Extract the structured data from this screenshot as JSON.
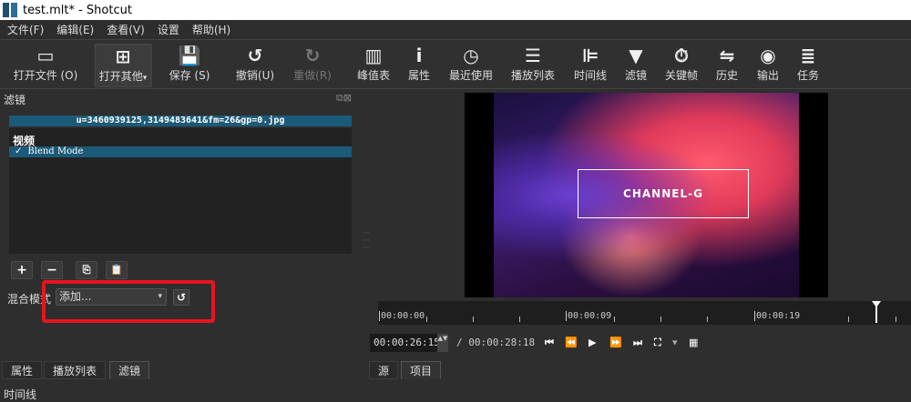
{
  "window": {
    "title": "test.mlt* - Shotcut"
  },
  "menu": [
    "文件(F)",
    "编辑(E)",
    "查看(V)",
    "设置",
    "帮助(H)"
  ],
  "toolbar": [
    {
      "label": "打开文件 (O)",
      "icon": "folder-icon",
      "glyph": "▭"
    },
    {
      "label": "打开其他",
      "icon": "open-other-icon",
      "glyph": "⊞",
      "active": true,
      "dropdown": "▾"
    },
    {
      "label": "保存 (S)",
      "icon": "save-icon",
      "glyph": "💾"
    },
    {
      "label": "撤销(U)",
      "icon": "undo-icon",
      "glyph": "↺"
    },
    {
      "label": "重做(R)",
      "icon": "redo-icon",
      "glyph": "↻",
      "disabled": true
    },
    {
      "label": "峰值表",
      "icon": "peak-meter-icon",
      "glyph": "▥"
    },
    {
      "label": "属性",
      "icon": "info-icon",
      "glyph": "i"
    },
    {
      "label": "最近使用",
      "icon": "clock-icon",
      "glyph": "◷"
    },
    {
      "label": "播放列表",
      "icon": "list-icon",
      "glyph": "☰"
    },
    {
      "label": "时间线",
      "icon": "timeline-icon",
      "glyph": "⊫"
    },
    {
      "label": "滤镜",
      "icon": "filter-icon",
      "glyph": "▼"
    },
    {
      "label": "关键帧",
      "icon": "stopwatch-icon",
      "glyph": "⏱"
    },
    {
      "label": "历史",
      "icon": "history-icon",
      "glyph": "⇋"
    },
    {
      "label": "输出",
      "icon": "disc-icon",
      "glyph": "◉"
    },
    {
      "label": "任务",
      "icon": "jobs-icon",
      "glyph": "≣"
    }
  ],
  "filters": {
    "title": "滤镜",
    "file": "u=3460939125,3149483641&fm=26&gp=0.jpg",
    "category": "视频",
    "items": [
      {
        "name": "Blend Mode",
        "checked": true,
        "check": "✓"
      }
    ],
    "buttons": {
      "add": "+",
      "remove": "−",
      "copy": "⎘",
      "paste": "📋"
    },
    "blend_label": "混合模式",
    "blend_value": "添加...",
    "dropdown_arrow": "▾",
    "reset": "↺"
  },
  "left_tabs": [
    "属性",
    "播放列表",
    "滤镜"
  ],
  "left_tab_selected": "滤镜",
  "bottom_label": "时间线",
  "preview": {
    "overlay_text": "CHANNEL-G"
  },
  "ruler": [
    "00:00:00",
    "00:00:09",
    "00:00:19"
  ],
  "transport": {
    "position": "00:00:26:15",
    "duration": "/ 00:00:28:18",
    "spin": "▲▼",
    "controls": [
      "⏮",
      "⏪",
      "▶",
      "⏩",
      "⏭",
      "⛶",
      "▾",
      "▦"
    ]
  },
  "right_tabs": [
    "源",
    "项目"
  ],
  "right_tab_selected": "项目",
  "colors": {
    "accent": "#1b5a78",
    "highlight": "#e8141e"
  }
}
